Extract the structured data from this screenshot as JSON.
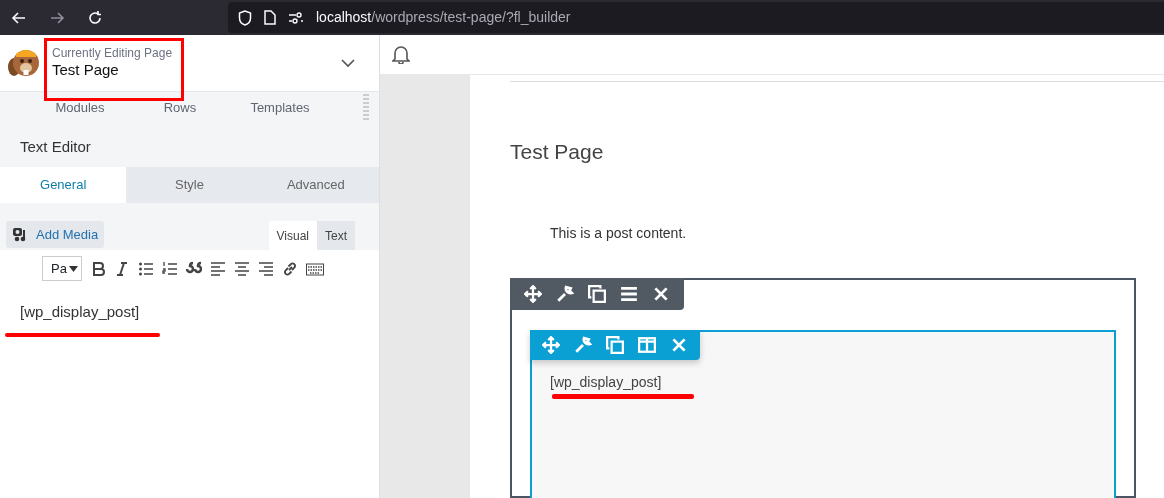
{
  "browser": {
    "url_host": "localhost",
    "url_path": "/wordpress/test-page/?fl_builder"
  },
  "header": {
    "subtitle": "Currently Editing Page",
    "title": "Test Page"
  },
  "panel_tabs": [
    {
      "label": "Modules",
      "selected": false
    },
    {
      "label": "Rows",
      "selected": false
    },
    {
      "label": "Templates",
      "selected": false
    }
  ],
  "module_title": "Text Editor",
  "settings_tabs": [
    {
      "label": "General",
      "selected": true
    },
    {
      "label": "Style",
      "selected": false
    },
    {
      "label": "Advanced",
      "selected": false
    }
  ],
  "add_media": "Add Media",
  "editor_modes": [
    {
      "label": "Visual",
      "selected": true
    },
    {
      "label": "Text",
      "selected": false
    }
  ],
  "format_select": "Pa",
  "editor_content": "[wp_display_post]",
  "page": {
    "title": "Test Page",
    "content": "This is a post content.",
    "module_text": "[wp_display_post]"
  }
}
